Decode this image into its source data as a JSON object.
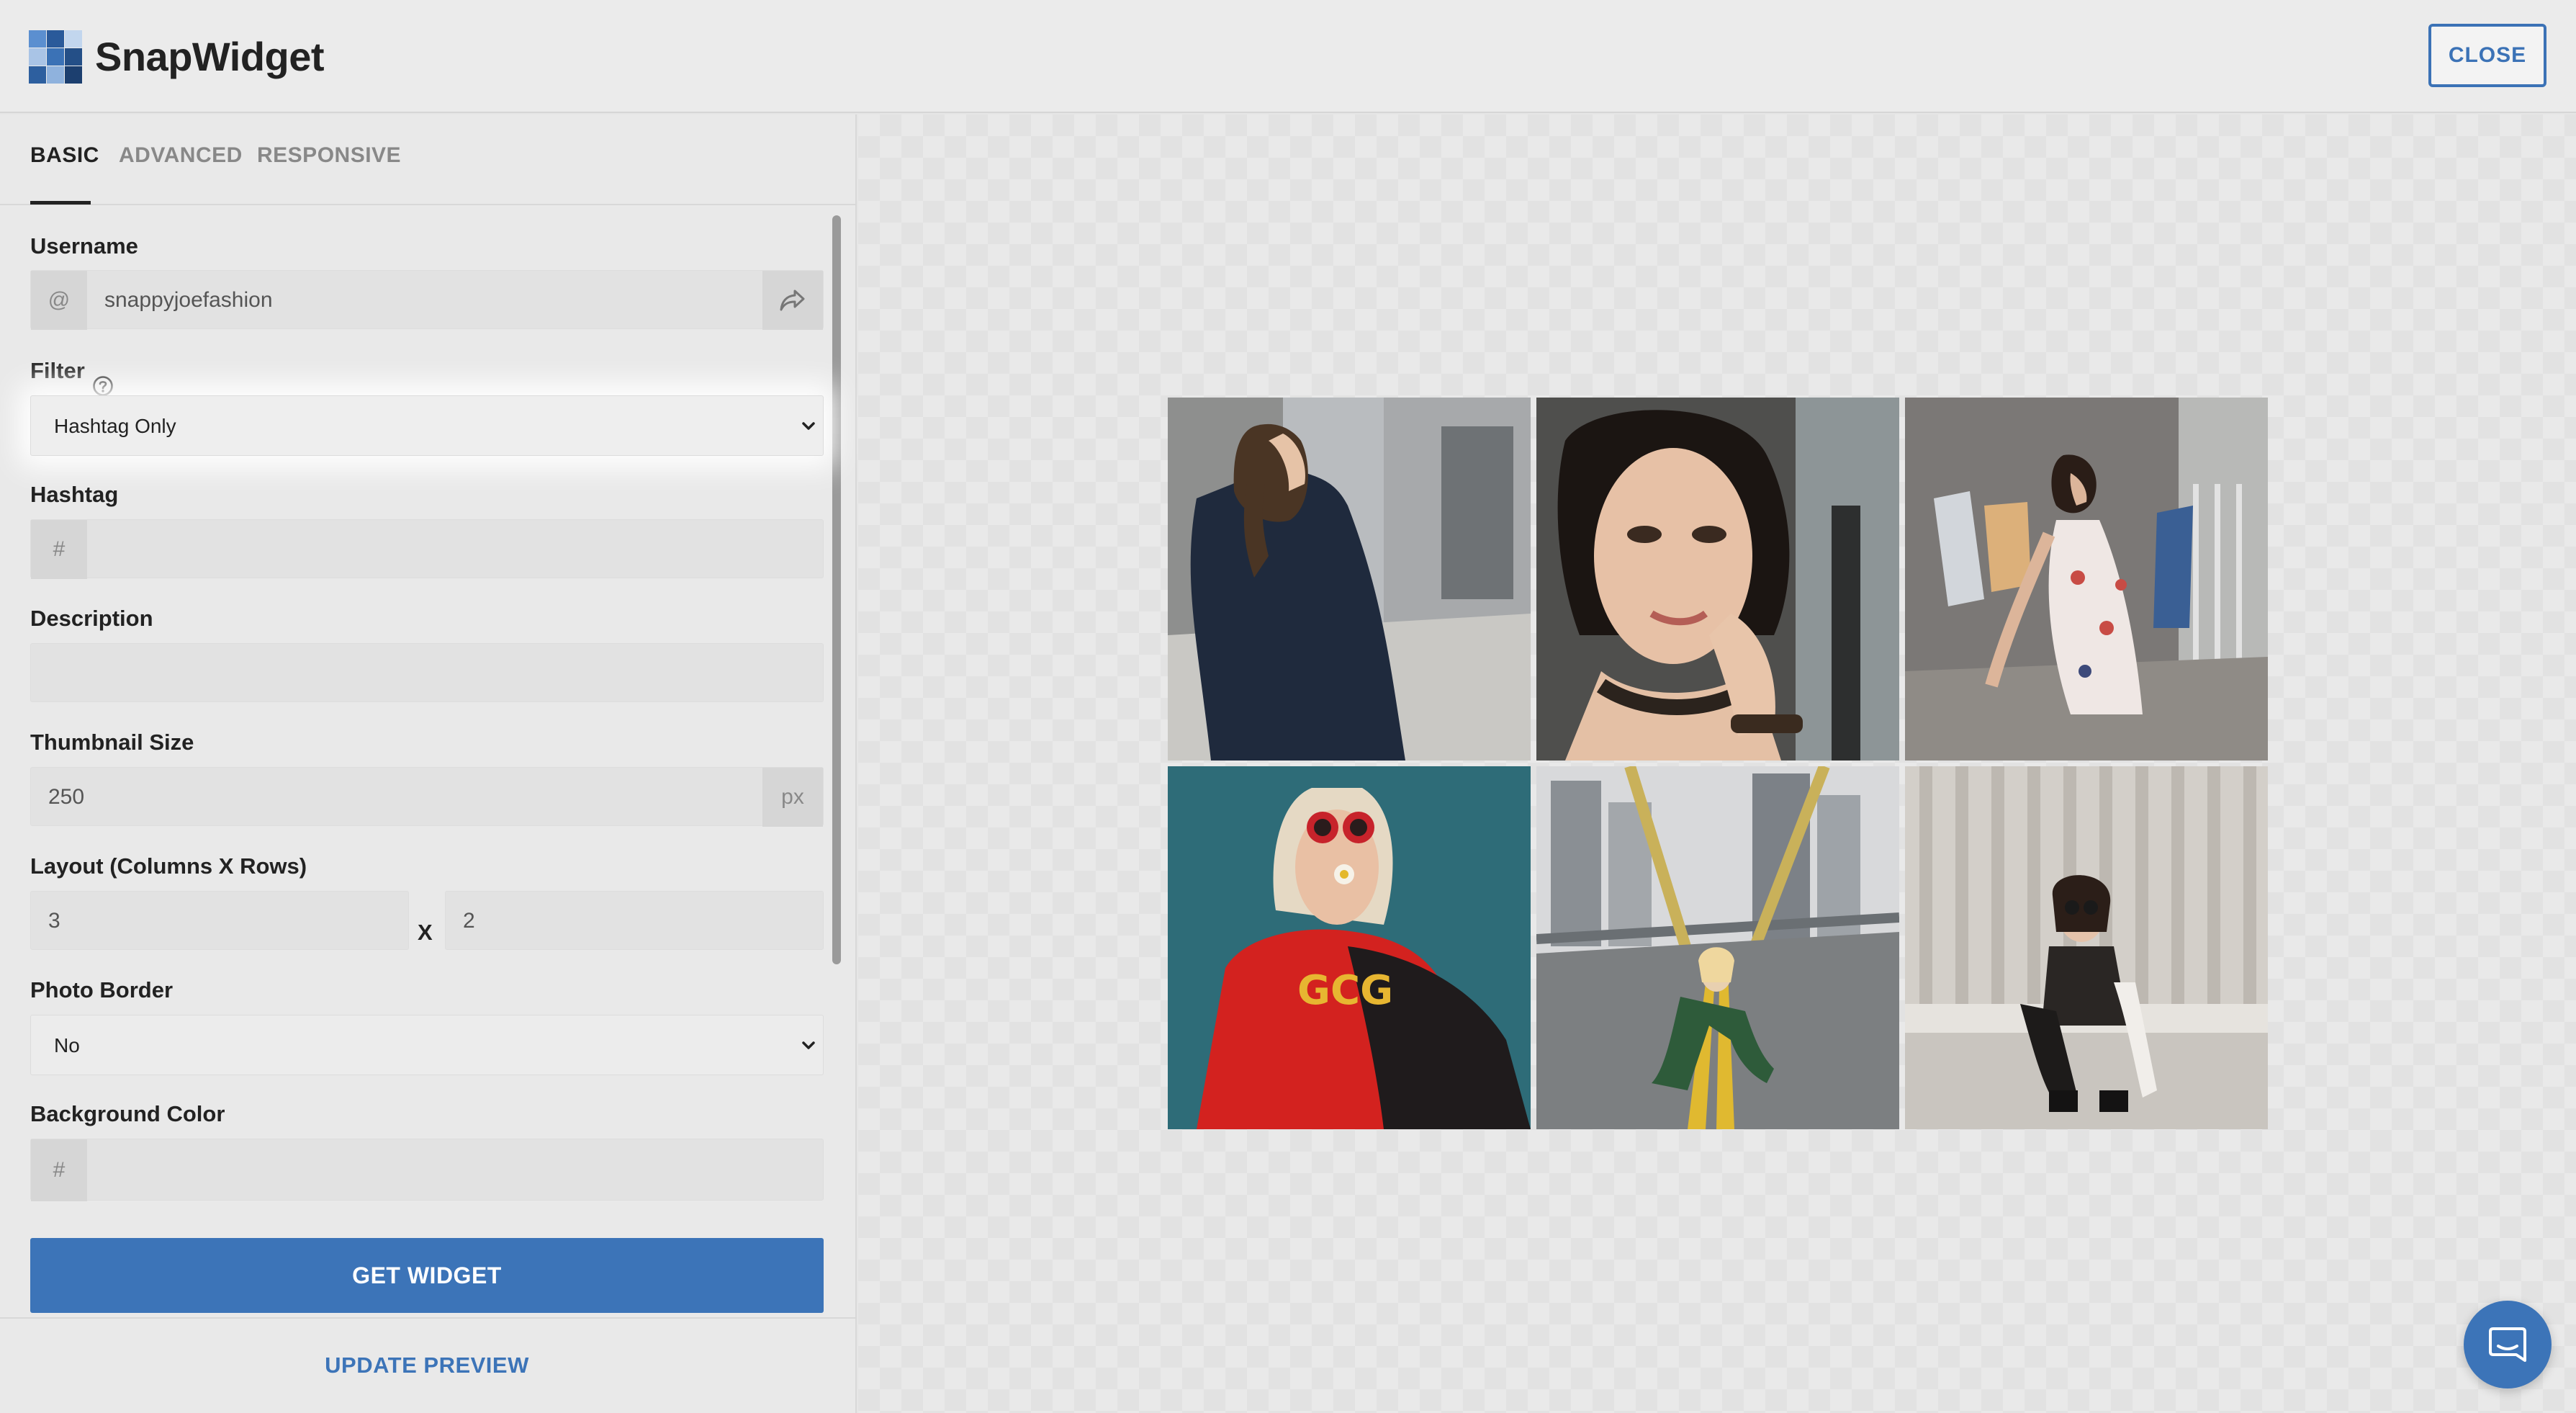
{
  "app": {
    "brand": "SnapWidget",
    "close_label": "CLOSE"
  },
  "tabs": [
    {
      "label": "BASIC",
      "active": true
    },
    {
      "label": "ADVANCED",
      "active": false
    },
    {
      "label": "RESPONSIVE",
      "active": false
    }
  ],
  "form": {
    "username": {
      "label": "Username",
      "prefix": "@",
      "value": "snappyjoefashion"
    },
    "filter": {
      "label": "Filter",
      "selected": "Hashtag Only"
    },
    "hashtag": {
      "label": "Hashtag",
      "prefix": "#",
      "value": ""
    },
    "description": {
      "label": "Description",
      "value": ""
    },
    "thumbnail_size": {
      "label": "Thumbnail Size",
      "value": "250",
      "suffix": "px"
    },
    "layout": {
      "label": "Layout (Columns X Rows)",
      "columns": "3",
      "separator": "X",
      "rows": "2"
    },
    "photo_border": {
      "label": "Photo Border",
      "selected": "No"
    },
    "background_color": {
      "label": "Background Color",
      "prefix": "#",
      "value": ""
    }
  },
  "footer": {
    "get_widget_label": "GET WIDGET",
    "update_preview_label": "UPDATE PREVIEW"
  },
  "preview": {
    "columns": 3,
    "rows": 2,
    "photos": [
      {
        "subject": "woman-plaid-coat-street"
      },
      {
        "subject": "woman-portrait-earrings"
      },
      {
        "subject": "woman-floral-dress-clothesline"
      },
      {
        "subject": "woman-sunglasses-red-shirt"
      },
      {
        "subject": "woman-crouching-bridge-road"
      },
      {
        "subject": "woman-crouching-curtain"
      }
    ]
  },
  "colors": {
    "accent": "#3c74b8",
    "background": "#e6e6e6"
  }
}
